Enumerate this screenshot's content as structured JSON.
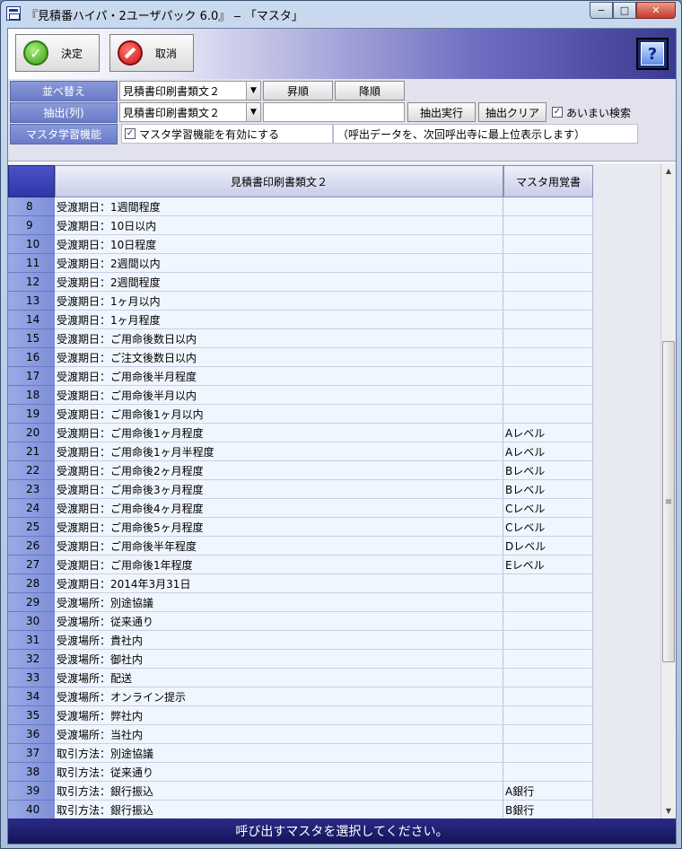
{
  "window": {
    "title": "『見積番ハイパ・2ユーザパック 6.0』 ‒ 「マスタ」",
    "min": "−",
    "max": "□",
    "close": "✕"
  },
  "toolbar": {
    "ok_label": "決定",
    "cancel_label": "取消",
    "help_label": "?"
  },
  "filter": {
    "sort_label": "並べ替え",
    "sort_value": "見積書印刷書類文２",
    "asc_label": "昇順",
    "desc_label": "降順",
    "extract_label": "抽出(列)",
    "extract_value": "見積書印刷書類文２",
    "extract_text": "",
    "run_label": "抽出実行",
    "clear_label": "抽出クリア",
    "fuzzy_label": "あいまい検索",
    "fuzzy_checked": true,
    "learn_label": "マスタ学習機能",
    "learn_check_label": "マスタ学習機能を有効にする",
    "learn_checked": true,
    "learn_note": "（呼出データを、次回呼出寺に最上位表示します）"
  },
  "grid": {
    "columns": [
      "見積書印刷書類文２",
      "マスタ用覚書"
    ],
    "rows": [
      {
        "n": "8",
        "a": "受渡期日：1週間程度",
        "b": ""
      },
      {
        "n": "9",
        "a": "受渡期日：10日以内",
        "b": ""
      },
      {
        "n": "10",
        "a": "受渡期日：10日程度",
        "b": ""
      },
      {
        "n": "11",
        "a": "受渡期日：2週間以内",
        "b": ""
      },
      {
        "n": "12",
        "a": "受渡期日：2週間程度",
        "b": ""
      },
      {
        "n": "13",
        "a": "受渡期日：1ヶ月以内",
        "b": ""
      },
      {
        "n": "14",
        "a": "受渡期日：1ヶ月程度",
        "b": ""
      },
      {
        "n": "15",
        "a": "受渡期日：ご用命後数日以内",
        "b": ""
      },
      {
        "n": "16",
        "a": "受渡期日：ご注文後数日以内",
        "b": ""
      },
      {
        "n": "17",
        "a": "受渡期日：ご用命後半月程度",
        "b": ""
      },
      {
        "n": "18",
        "a": "受渡期日：ご用命後半月以内",
        "b": ""
      },
      {
        "n": "19",
        "a": "受渡期日：ご用命後1ヶ月以内",
        "b": ""
      },
      {
        "n": "20",
        "a": "受渡期日：ご用命後1ヶ月程度",
        "b": "Aレベル"
      },
      {
        "n": "21",
        "a": "受渡期日：ご用命後1ヶ月半程度",
        "b": "Aレベル"
      },
      {
        "n": "22",
        "a": "受渡期日：ご用命後2ヶ月程度",
        "b": "Bレベル"
      },
      {
        "n": "23",
        "a": "受渡期日：ご用命後3ヶ月程度",
        "b": "Bレベル"
      },
      {
        "n": "24",
        "a": "受渡期日：ご用命後4ヶ月程度",
        "b": "Cレベル"
      },
      {
        "n": "25",
        "a": "受渡期日：ご用命後5ヶ月程度",
        "b": "Cレベル"
      },
      {
        "n": "26",
        "a": "受渡期日：ご用命後半年程度",
        "b": "Dレベル"
      },
      {
        "n": "27",
        "a": "受渡期日：ご用命後1年程度",
        "b": "Eレベル"
      },
      {
        "n": "28",
        "a": "受渡期日：2014年3月31日",
        "b": ""
      },
      {
        "n": "29",
        "a": "受渡場所：別途協議",
        "b": ""
      },
      {
        "n": "30",
        "a": "受渡場所：従来通り",
        "b": ""
      },
      {
        "n": "31",
        "a": "受渡場所：貴社内",
        "b": ""
      },
      {
        "n": "32",
        "a": "受渡場所：御社内",
        "b": ""
      },
      {
        "n": "33",
        "a": "受渡場所：配送",
        "b": ""
      },
      {
        "n": "34",
        "a": "受渡場所：オンライン提示",
        "b": ""
      },
      {
        "n": "35",
        "a": "受渡場所：弊社内",
        "b": ""
      },
      {
        "n": "36",
        "a": "受渡場所：当社内",
        "b": ""
      },
      {
        "n": "37",
        "a": "取引方法：別途協議",
        "b": ""
      },
      {
        "n": "38",
        "a": "取引方法：従来通り",
        "b": ""
      },
      {
        "n": "39",
        "a": "取引方法：銀行振込",
        "b": "A銀行"
      },
      {
        "n": "40",
        "a": "取引方法：銀行振込",
        "b": "B銀行"
      }
    ]
  },
  "scroll": {
    "up": "▲",
    "down": "▼",
    "grip": "≡"
  },
  "status": {
    "message": "呼び出すマスタを選択してください。"
  }
}
